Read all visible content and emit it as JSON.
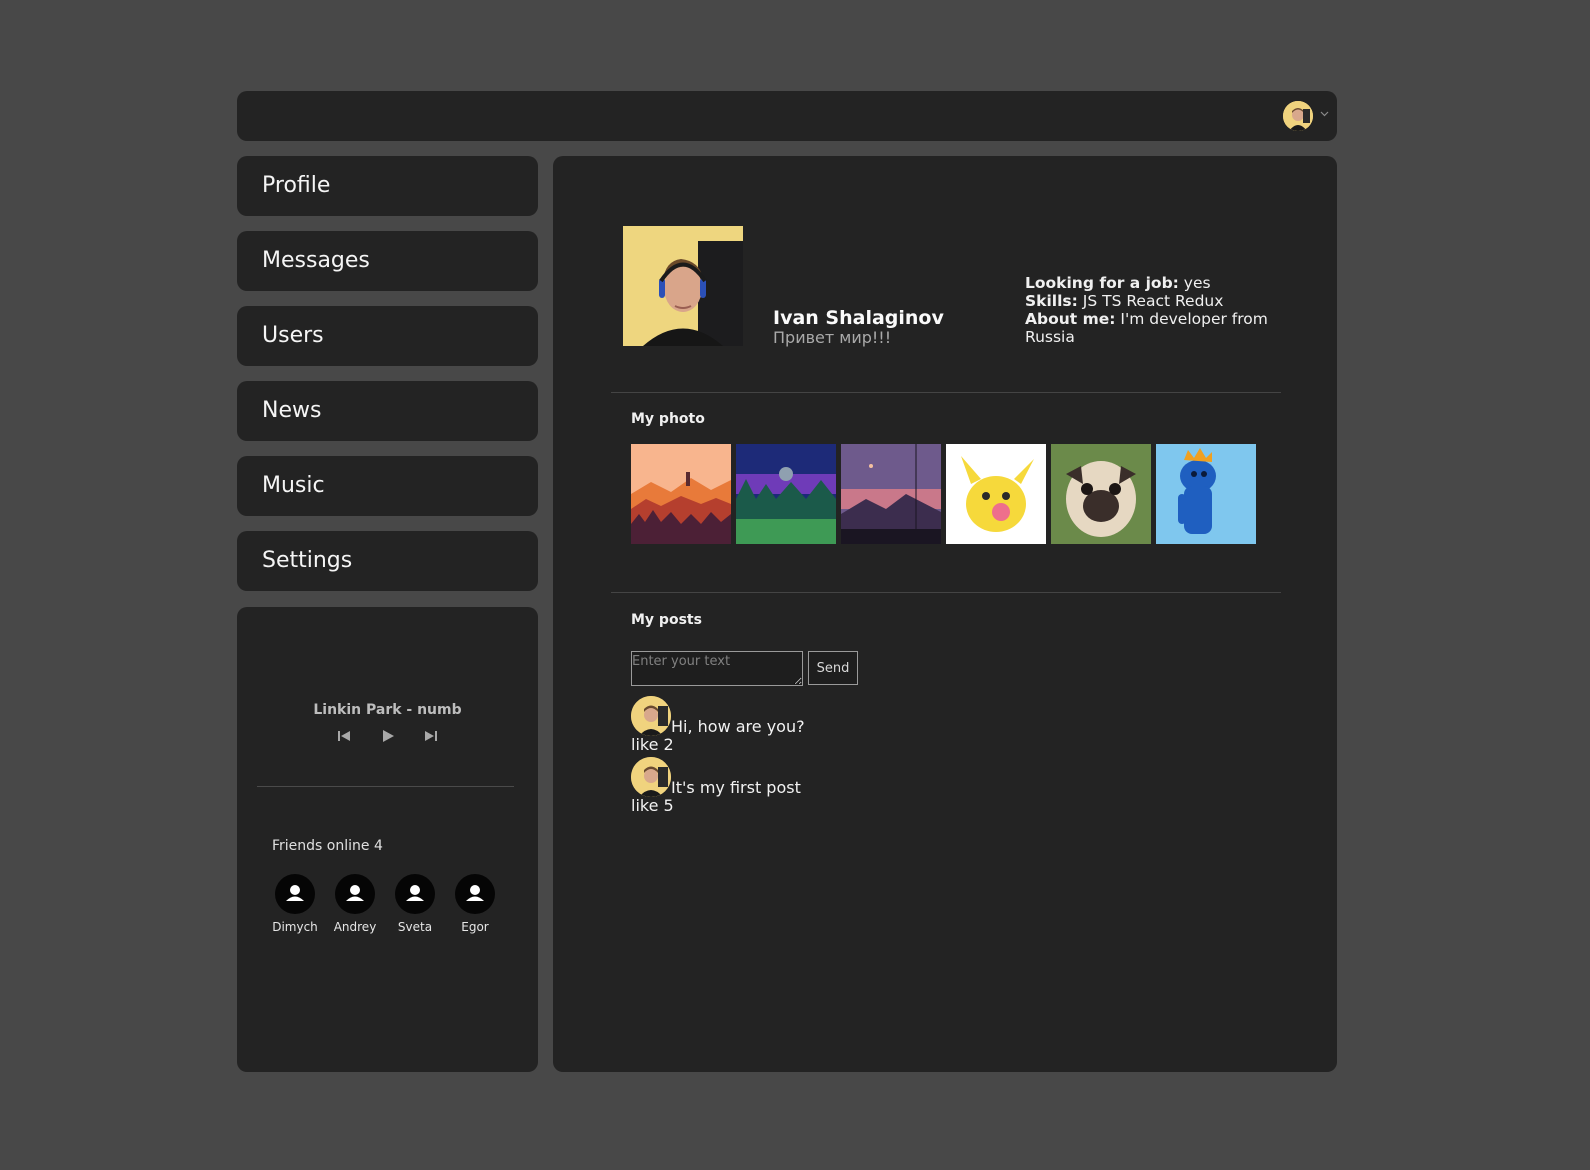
{
  "nav": {
    "items": [
      {
        "label": "Profile"
      },
      {
        "label": "Messages"
      },
      {
        "label": "Users"
      },
      {
        "label": "News"
      },
      {
        "label": "Music"
      },
      {
        "label": "Settings"
      }
    ]
  },
  "player": {
    "track": "Linkin Park - numb",
    "icons": [
      "previous-icon",
      "play-icon",
      "next-icon"
    ]
  },
  "friends": {
    "label": "Friends online 4",
    "items": [
      {
        "name": "Dimych"
      },
      {
        "name": "Andrey"
      },
      {
        "name": "Sveta"
      },
      {
        "name": "Egor"
      }
    ]
  },
  "profile": {
    "name": "Ivan Shalaginov",
    "status": "Привет мир!!!",
    "job_label": "Looking for a job:",
    "job_value": " yes",
    "skills_label": "Skills:",
    "skills_value": " JS TS React Redux",
    "about_label": "About me:",
    "about_value": " I'm developer from Russia"
  },
  "photos": {
    "title": "My photo",
    "items": [
      "orange-forest-landscape",
      "night-forest-satellite",
      "purple-mountain-dusk",
      "pikachu-lollipop",
      "pug-dog",
      "blue-monster-crown"
    ]
  },
  "posts": {
    "title": "My posts",
    "placeholder": "Enter your text",
    "send_label": "Send",
    "items": [
      {
        "text": "Hi, how are you?",
        "likes": "like 2"
      },
      {
        "text": "It's my first post",
        "likes": "like 5"
      }
    ]
  },
  "colors": {
    "page_bg": "#484848",
    "panel_bg": "#232323"
  }
}
